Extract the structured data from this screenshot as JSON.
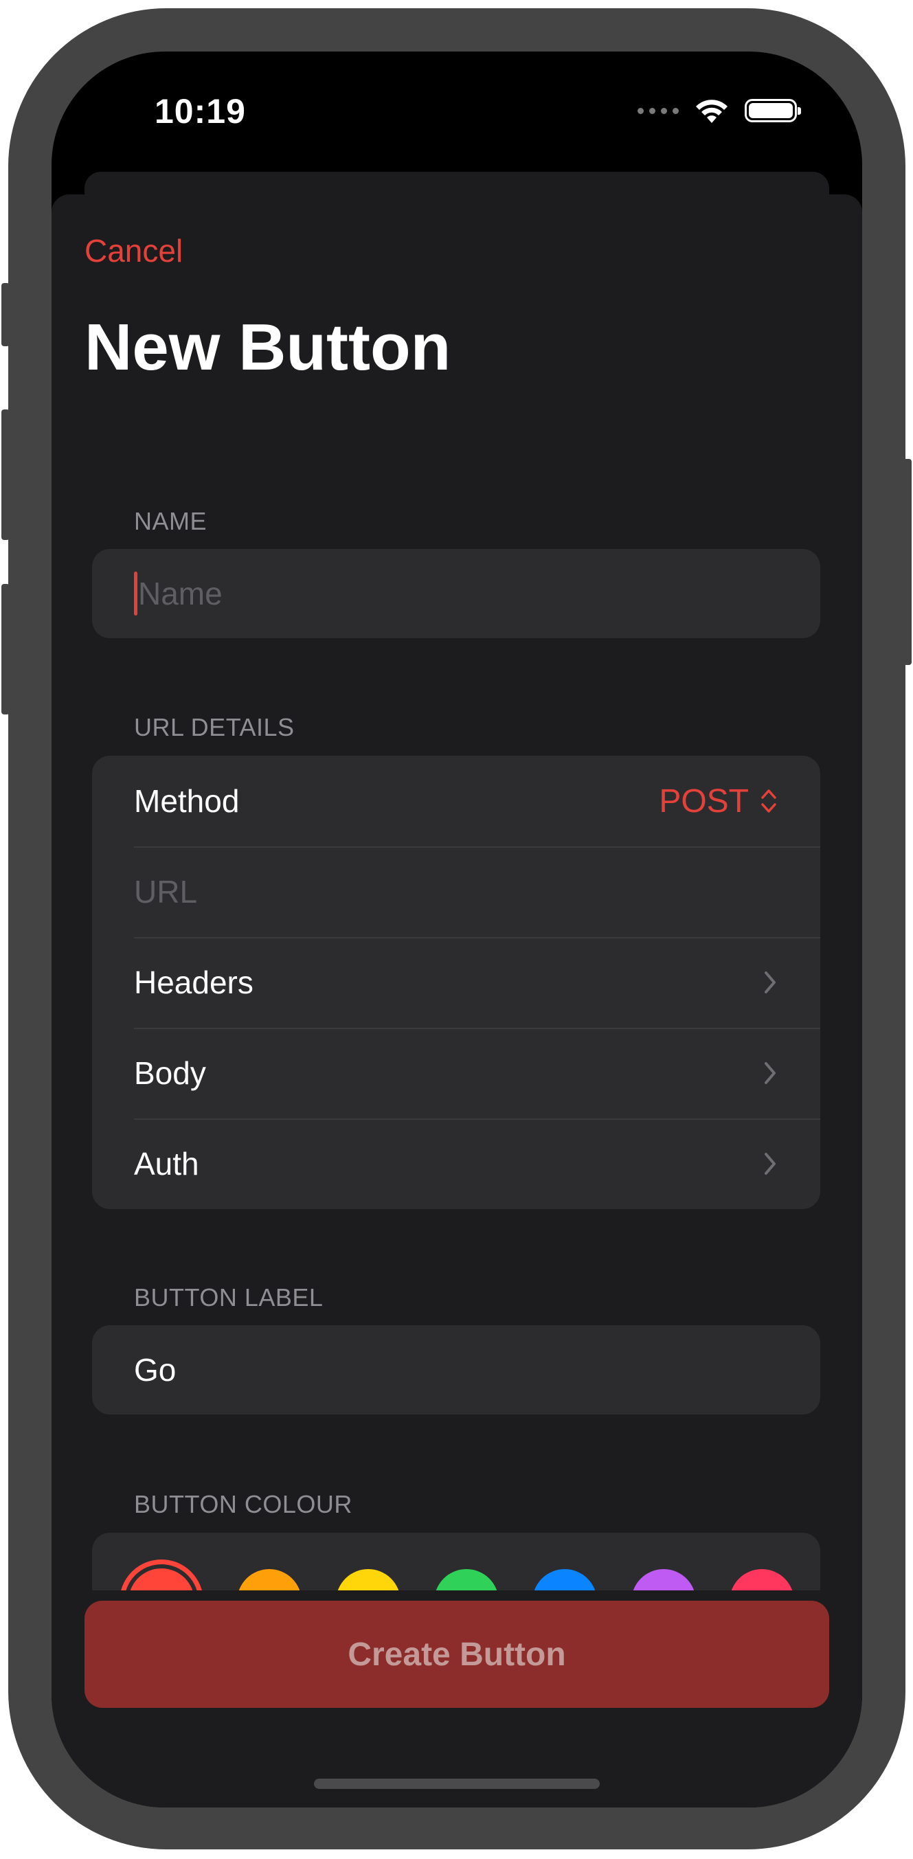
{
  "status_bar": {
    "time": "10:19",
    "signal_icon": "cellular-signal-icon",
    "wifi_icon": "wifi-icon",
    "battery_icon": "battery-icon"
  },
  "header": {
    "cancel_label": "Cancel",
    "title": "New Button"
  },
  "sections": {
    "name": {
      "label": "NAME",
      "placeholder": "Name",
      "value": ""
    },
    "url_details": {
      "label": "URL DETAILS",
      "method_label": "Method",
      "method_value": "POST",
      "url_placeholder": "URL",
      "headers_label": "Headers",
      "body_label": "Body",
      "auth_label": "Auth"
    },
    "button_label": {
      "label": "BUTTON LABEL",
      "value": "Go"
    },
    "button_colour": {
      "label": "BUTTON COLOUR",
      "colors": [
        {
          "name": "red",
          "hex": "#ff453a",
          "selected": true
        },
        {
          "name": "orange",
          "hex": "#ff9f0a",
          "selected": false
        },
        {
          "name": "yellow",
          "hex": "#ffd60a",
          "selected": false
        },
        {
          "name": "green",
          "hex": "#30d158",
          "selected": false
        },
        {
          "name": "blue",
          "hex": "#0a84ff",
          "selected": false
        },
        {
          "name": "purple",
          "hex": "#bf5af2",
          "selected": false
        },
        {
          "name": "pink",
          "hex": "#ff375f",
          "selected": false
        }
      ]
    }
  },
  "footer": {
    "create_label": "Create Button",
    "create_enabled": false,
    "create_bg": "#8c2d2b",
    "create_text_color": "#c49a98"
  },
  "theme": {
    "accent": "#e5413b",
    "background": "#1c1c1e",
    "group_background": "#2c2c2e",
    "secondary_text": "#8e8e93",
    "chevron_color": "#6e6e73"
  }
}
